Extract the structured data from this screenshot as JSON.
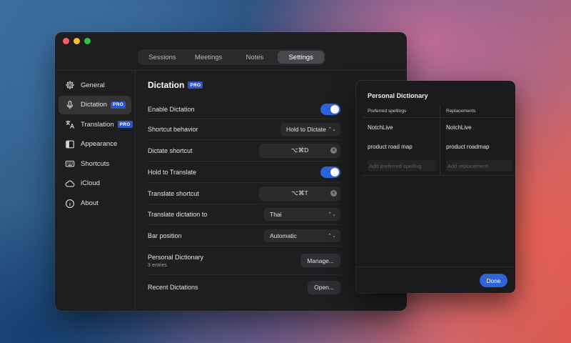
{
  "tabs": [
    "Sessions",
    "Meetings",
    "Notes",
    "Settings"
  ],
  "sidebar": {
    "items": [
      {
        "label": "General",
        "icon": "gear-icon"
      },
      {
        "label": "Dictation",
        "icon": "microphone-icon",
        "badge": "PRO"
      },
      {
        "label": "Translation",
        "icon": "translate-icon",
        "badge": "PRO"
      },
      {
        "label": "Appearance",
        "icon": "sidebar-panel-icon"
      },
      {
        "label": "Shortcuts",
        "icon": "keyboard-icon"
      },
      {
        "label": "iCloud",
        "icon": "cloud-icon"
      },
      {
        "label": "About",
        "icon": "info-icon"
      }
    ]
  },
  "main": {
    "title": "Dictation",
    "badge": "PRO",
    "rows": {
      "enable_dictation": {
        "label": "Enable Dictation"
      },
      "shortcut_behavior": {
        "label": "Shortcut behavior",
        "value": "Hold to Dictate"
      },
      "dictate_shortcut": {
        "label": "Dictate shortcut",
        "value": "⌥⌘D"
      },
      "hold_to_translate": {
        "label": "Hold to Translate"
      },
      "translate_shortcut": {
        "label": "Translate shortcut",
        "value": "⌥⌘T"
      },
      "translate_to": {
        "label": "Translate dictation to",
        "value": "Thai"
      },
      "bar_position": {
        "label": "Bar position",
        "value": "Automatic"
      },
      "personal_dictionary": {
        "label": "Personal Dictionary",
        "sub": "3 entries",
        "button": "Manage..."
      },
      "recent_dictations": {
        "label": "Recent Dictations",
        "button": "Open..."
      }
    }
  },
  "dictionary": {
    "title": "Personal Dictionary",
    "columns": [
      "Preferred spellings",
      "Replacements"
    ],
    "rows": [
      [
        "NotchLive",
        "NotchLive"
      ],
      [
        "product road map",
        "product roadmap"
      ]
    ],
    "placeholders": [
      "Add preferred spelling",
      "Add replacement"
    ],
    "done_label": "Done"
  },
  "colors": {
    "accent": "#2f63d8",
    "pro_badge": "#2f56c8"
  }
}
